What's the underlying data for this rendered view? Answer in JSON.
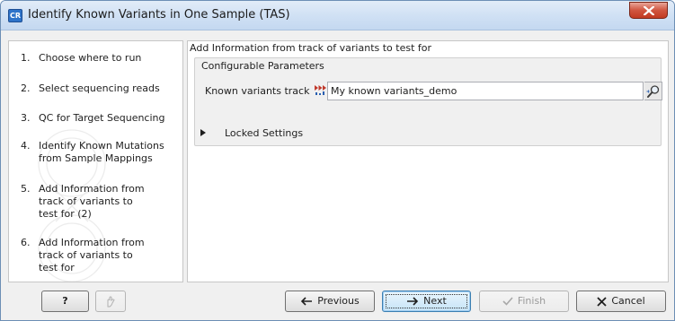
{
  "window": {
    "title": "Identify Known Variants in One Sample (TAS)",
    "app_icon_text": "CR"
  },
  "sidebar": {
    "steps": [
      {
        "num": "1.",
        "label": "Choose where to run"
      },
      {
        "num": "2.",
        "label": "Select sequencing reads"
      },
      {
        "num": "3.",
        "label": "QC for Target Sequencing"
      },
      {
        "num": "4.",
        "label": "Identify Known Mutations\nfrom Sample Mappings"
      },
      {
        "num": "5.",
        "label": "Add Information from\ntrack of variants to\ntest for (2)"
      },
      {
        "num": "6.",
        "label": "Add Information from\ntrack of variants to\ntest for"
      }
    ]
  },
  "main": {
    "heading": "Add Information from track of variants to test for",
    "params_title": "Configurable Parameters",
    "track_label": "Known variants track",
    "track_value": "My known variants_demo",
    "locked_label": "Locked Settings"
  },
  "buttons": {
    "help": "?",
    "previous": "Previous",
    "next": "Next",
    "finish": "Finish",
    "cancel": "Cancel"
  },
  "colors": {
    "title_bar": "#cfe0f4",
    "close_button": "#c9442c",
    "dialog_bg": "#f0f0f0",
    "next_button": "#c5e3f7"
  }
}
